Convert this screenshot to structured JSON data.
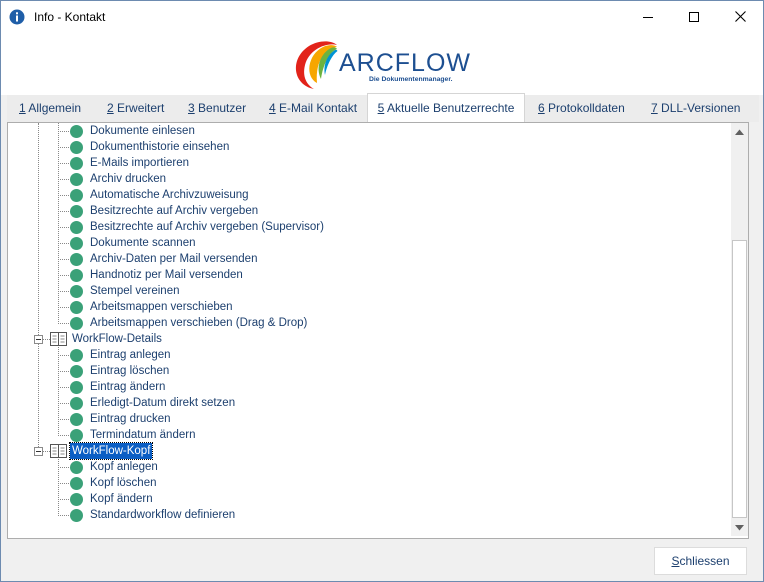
{
  "window": {
    "title": "Info - Kontakt",
    "info_icon": "info-icon",
    "controls": [
      "minimize-icon",
      "maximize-icon",
      "close-icon"
    ]
  },
  "logo": {
    "wordmark": "ARCFLOW",
    "tagline": "Die Dokumentenmanager.",
    "colors": [
      "#e2231a",
      "#f7a600",
      "#6cb33f",
      "#0093d3",
      "#1d4f91"
    ]
  },
  "tabs": [
    {
      "key": "1",
      "label": "Allgemein"
    },
    {
      "key": "2",
      "label": "Erweitert"
    },
    {
      "key": "3",
      "label": "Benutzer"
    },
    {
      "key": "4",
      "label": "E-Mail Kontakt"
    },
    {
      "key": "5",
      "label": "Aktuelle Benutzerrechte",
      "active": true
    },
    {
      "key": "6",
      "label": "Protokolldaten"
    },
    {
      "key": "7",
      "label": "DLL-Versionen"
    }
  ],
  "tree": {
    "group1_items": [
      "Dokumente einlesen",
      "Dokumenthistorie einsehen",
      "E-Mails importieren",
      "Archiv drucken",
      "Automatische Archivzuweisung",
      "Besitzrechte auf Archiv vergeben",
      "Besitzrechte auf Archiv vergeben (Supervisor)",
      "Dokumente scannen",
      "Archiv-Daten per Mail versenden",
      "Handnotiz per Mail versenden",
      "Stempel vereinen",
      "Arbeitsmappen verschieben",
      "Arbeitsmappen verschieben (Drag & Drop)"
    ],
    "folder_details": {
      "label": "WorkFlow-Details",
      "items": [
        "Eintrag anlegen",
        "Eintrag löschen",
        "Eintrag ändern",
        "Erledigt-Datum direkt setzen",
        "Eintrag drucken",
        "Termindatum ändern"
      ]
    },
    "folder_kopf": {
      "label": "WorkFlow-Kopf",
      "selected": true,
      "items": [
        "Kopf anlegen",
        "Kopf löschen",
        "Kopf ändern",
        "Standardworkflow definieren"
      ]
    },
    "status_color": "#3aa178",
    "selection_color": "#0b5ec4"
  },
  "footer": {
    "close_key": "S",
    "close_rest": "chliessen"
  }
}
